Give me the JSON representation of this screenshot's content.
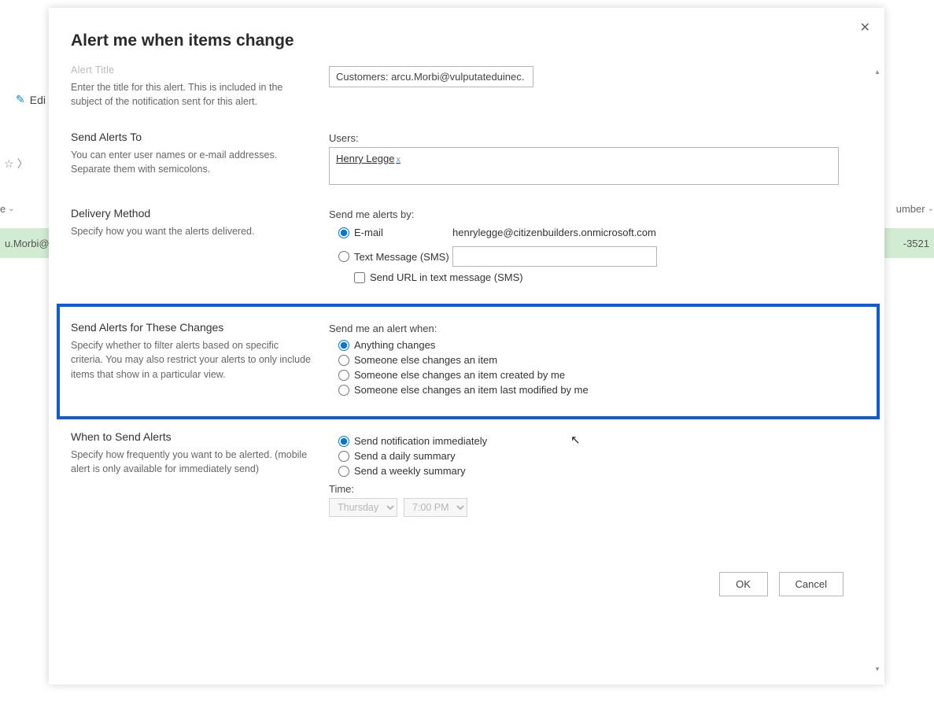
{
  "modal": {
    "title": "Alert me when items change",
    "alert_title": {
      "heading": "Alert Title",
      "description": "Enter the title for this alert. This is included in the subject of the notification sent for this alert.",
      "value": "Customers: arcu.Morbi@vulputateduinec."
    },
    "send_to": {
      "heading": "Send Alerts To",
      "description": "You can enter user names or e-mail addresses. Separate them with semicolons.",
      "users_label": "Users:",
      "user_chip": "Henry Legge",
      "user_chip_x": "x"
    },
    "delivery": {
      "heading": "Delivery Method",
      "description": "Specify how you want the alerts delivered.",
      "send_by_label": "Send me alerts by:",
      "opt_email": "E-mail",
      "email_value": "henrylegge@citizenbuilders.onmicrosoft.com",
      "opt_sms": "Text Message (SMS)",
      "opt_send_url": "Send URL in text message (SMS)"
    },
    "changes": {
      "heading": "Send Alerts for These Changes",
      "description": "Specify whether to filter alerts based on specific criteria. You may also restrict your alerts to only include items that show in a particular view.",
      "send_when_label": "Send me an alert when:",
      "opt1": "Anything changes",
      "opt2": "Someone else changes an item",
      "opt3": "Someone else changes an item created by me",
      "opt4": "Someone else changes an item last modified by me"
    },
    "when": {
      "heading": "When to Send Alerts",
      "description": "Specify how frequently you want to be alerted. (mobile alert is only available for immediately send)",
      "opt1": "Send notification immediately",
      "opt2": "Send a daily summary",
      "opt3": "Send a weekly summary",
      "time_label": "Time:",
      "day": "Thursday",
      "time": "7:00 PM"
    },
    "footer": {
      "ok": "OK",
      "cancel": "Cancel"
    }
  },
  "background": {
    "edit": "Edi",
    "col_e": "e",
    "col_number": "umber",
    "row_email": "u.Morbi@",
    "row_number": "-3521",
    "star": "☆",
    "chev": "〉"
  }
}
